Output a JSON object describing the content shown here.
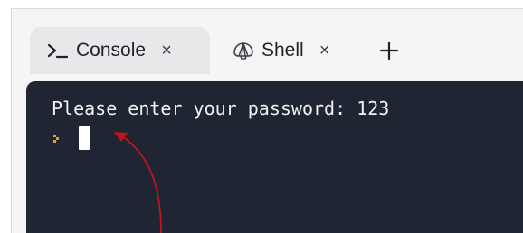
{
  "tabs": [
    {
      "label": "Console",
      "icon": "console-prompt-icon",
      "active": true,
      "close_glyph": "×"
    },
    {
      "label": "Shell",
      "icon": "shell-icon",
      "active": false,
      "close_glyph": "×"
    }
  ],
  "add_tab_glyph": "+",
  "terminal": {
    "output_line": "Please enter your password: 123",
    "prompt_icon": "prompt-chevron-icon",
    "input_value": ""
  },
  "colors": {
    "terminal_bg": "#1f2533",
    "prompt_chevron": "#d4a72c",
    "annotation_arrow": "#c0141c"
  }
}
